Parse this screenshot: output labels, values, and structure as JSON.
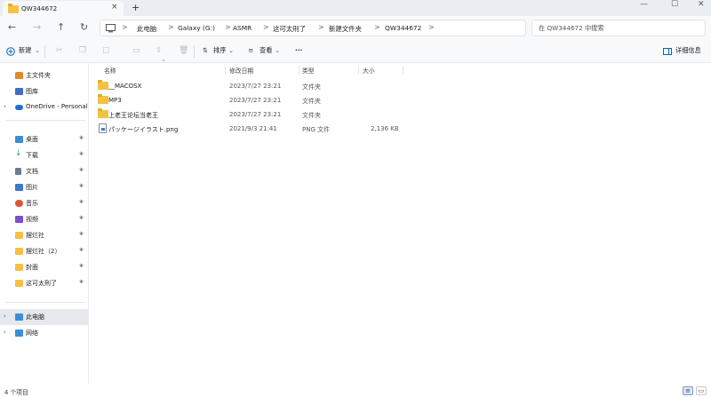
{
  "window": {
    "tab_title": "QW344672",
    "tab_close": "×",
    "new_tab": "+",
    "minimize": "—",
    "maximize": "☐",
    "close": "✕"
  },
  "address": {
    "back": "←",
    "forward": "→",
    "up": "↑",
    "refresh": "↻",
    "separator": ">",
    "breadcrumbs": [
      "此电脑",
      "Galaxy (G:)",
      "ASMR",
      "这可太刑了",
      "新建文件夹",
      "QW344672"
    ],
    "search_placeholder": "在 QW344672 中搜索"
  },
  "toolbar": {
    "new_label": "新建",
    "sort_label": "排序",
    "view_label": "查看",
    "more": "···",
    "details_label": "详细信息"
  },
  "sidebar": {
    "items": [
      {
        "label": "主文件夹",
        "icon": "home-icon",
        "color": "#e08a2c"
      },
      {
        "label": "图库",
        "icon": "gallery-icon",
        "color": "#3d6fc4"
      },
      {
        "label": "OneDrive - Personal",
        "icon": "cloud-icon",
        "color": "#1f6fd1"
      },
      {
        "label": "桌面",
        "icon": "desktop-icon",
        "color": "#3a8fd8"
      },
      {
        "label": "下载",
        "icon": "download-icon",
        "color": "#2a9d8f"
      },
      {
        "label": "文档",
        "icon": "documents-icon",
        "color": "#6b7c93"
      },
      {
        "label": "图片",
        "icon": "pictures-icon",
        "color": "#3979d0"
      },
      {
        "label": "音乐",
        "icon": "music-icon",
        "color": "#e0533a"
      },
      {
        "label": "视频",
        "icon": "videos-icon",
        "color": "#7b4ed1"
      },
      {
        "label": "摆烂社",
        "icon": "folder-icon",
        "color": "#f4c241"
      },
      {
        "label": "摆烂社（2）",
        "icon": "folder-icon",
        "color": "#f4c241"
      },
      {
        "label": "封面",
        "icon": "folder-icon",
        "color": "#f4c241"
      },
      {
        "label": "这可太刑了",
        "icon": "folder-icon",
        "color": "#f4c241"
      },
      {
        "label": "此电脑",
        "icon": "computer-icon",
        "color": "#3a8fd8"
      },
      {
        "label": "网络",
        "icon": "network-icon",
        "color": "#3a8fd8"
      }
    ],
    "expand_glyph": "›",
    "pin_glyph": "✱"
  },
  "columns": {
    "name": "名称",
    "modified": "修改日期",
    "type": "类型",
    "size": "大小"
  },
  "files": [
    {
      "name": "__MACOSX",
      "modified": "2023/7/27 23:21",
      "type": "文件夹",
      "size": "",
      "kind": "folder"
    },
    {
      "name": "MP3",
      "modified": "2023/7/27 23:21",
      "type": "文件夹",
      "size": "",
      "kind": "folder"
    },
    {
      "name": "上老王论坛当老王",
      "modified": "2023/7/27 23:21",
      "type": "文件夹",
      "size": "",
      "kind": "folder"
    },
    {
      "name": "パッケージイラスト.png",
      "modified": "2021/9/3 21:41",
      "type": "PNG 文件",
      "size": "2,136 KB",
      "kind": "png"
    }
  ],
  "status": {
    "item_count": "4 个项目"
  },
  "colors": {
    "accent": "#0067c0",
    "folder": "#f4c241",
    "selected_bg": "#e5e9ee"
  }
}
